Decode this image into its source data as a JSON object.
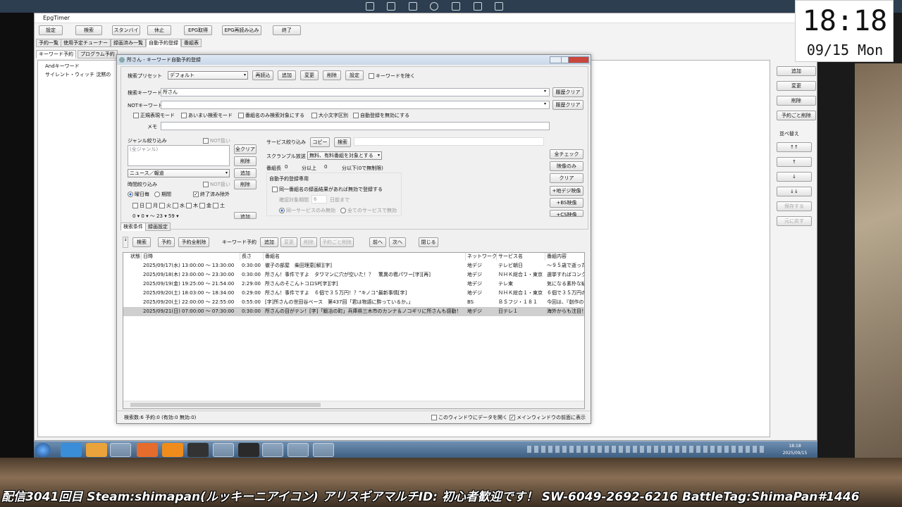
{
  "app_title": "EpgTimer",
  "clock": {
    "time": "18:18",
    "date": "09/15 Mon"
  },
  "toolbar": [
    "設定",
    "検索",
    "スタンバイ",
    "休止",
    "EPG取得",
    "EPG再読み込み",
    "終了"
  ],
  "main_tabs": [
    "予約一覧",
    "使用予定チューナー",
    "録画済み一覧",
    "自動予約登録",
    "番組表"
  ],
  "sub_tabs": [
    "キーワード予約",
    "プログラム予約"
  ],
  "keyword_list": {
    "header": "Andキーワード",
    "item": "サイレント・ウィッチ 沈黙の"
  },
  "right_buttons": [
    "追加",
    "変更",
    "削除",
    "予約ごと削除"
  ],
  "sort": {
    "label": "並べ替え",
    "buttons": [
      "↑↑",
      "↑",
      "↓",
      "↓↓"
    ],
    "save": "保存する",
    "restore": "元に戻す"
  },
  "dialog": {
    "title": "所さん - キーワード自動予約登録",
    "preset_label": "検索プリセット",
    "preset_value": "デフォルト",
    "preset_buttons": [
      "再読込",
      "追加",
      "変更",
      "削除",
      "設定"
    ],
    "exclude_keyword": "キーワードを除く",
    "keyword_label": "検索キーワード",
    "keyword_value": "所さん",
    "not_keyword_label": "NOTキーワード",
    "history_clear": "履歴クリア",
    "options": [
      "正規表現モード",
      "あいまい検索モード",
      "番組名のみ検索対象にする",
      "大小文字区別",
      "自動登録を無効にする"
    ],
    "memo_label": "メモ",
    "genre_label": "ジャンル絞り込み",
    "not_label": "NOT扱い",
    "genre_all": "(全ジャンル)",
    "genre_buttons": [
      "全クリア",
      "削除",
      "追加",
      "削除"
    ],
    "genre_select": "ニュース／報道",
    "time_label": "時間絞り込み",
    "weekday": "曜日毎",
    "period": "期間",
    "exclude_ended": "終了済み除外",
    "days": [
      "日",
      "月",
      "火",
      "水",
      "木",
      "金",
      "土"
    ],
    "time_row": "0 ▾ 0 ▾ ～ 23 ▾ 59 ▾",
    "time_add": "追加",
    "service_label": "サービス絞り込み",
    "copy": "コピー",
    "search": "検索",
    "scramble_label": "スクランブル放送",
    "scramble_value": "無料、有料番組を対象とする",
    "length_label": "番組長",
    "length_min": "0",
    "length_min_unit": "分以上",
    "length_max": "0",
    "length_max_unit": "分以下(0で無制限)",
    "auto_label": "自動予約登録専用",
    "same_title": "同一番組名の録画結果があれば無効で登録する",
    "confirm_label": "確認対象期間",
    "confirm_value": "6",
    "confirm_unit": "日前まで",
    "same_service": "同一サービスのみ無効",
    "all_service": "全てのサービスで無効",
    "side_buttons": [
      "全チェック",
      "映像のみ",
      "クリア",
      "+地デジ映像",
      "+BS映像",
      "+CS映像"
    ],
    "bottom_tabs": [
      "検索条件",
      "録画設定"
    ],
    "actions": [
      "検索",
      "予約",
      "予約全削除"
    ],
    "kw_label": "キーワード予約",
    "kw_buttons": [
      "追加",
      "変更",
      "削除",
      "予約ごと削除"
    ],
    "nav": [
      "前へ",
      "次へ"
    ],
    "close": "閉じる",
    "headers": [
      "状態",
      "日時",
      "長さ",
      "番組名",
      "ネットワーク",
      "サービス名",
      "番組内容"
    ],
    "rows": [
      {
        "dt": "2025/09/17(水) 13:00:00 ～ 13:30:00",
        "len": "0:30:00",
        "title": "徹子の部屋　柴田理恵[解][字]",
        "net": "地デジ",
        "svc": "テレビ朝日",
        "desc": "～９５歳で逝った"
      },
      {
        "dt": "2025/09/18(木) 23:00:00 ～ 23:30:00",
        "len": "0:30:00",
        "title": "所さん！事件ですよ　タワマンに穴が空いた！？　驚異の雹パワー[字][再]",
        "net": "地デジ",
        "svc": "ＮＨＫ総合１・東京",
        "desc": "選挙すればコンク"
      },
      {
        "dt": "2025/09/19(金) 19:25:00 ～ 21:54:00",
        "len": "2:29:00",
        "title": "所さんのそこんトコロSP[字][字]",
        "net": "地デジ",
        "svc": "テレ東",
        "desc": "気になる素朴な疑"
      },
      {
        "dt": "2025/09/20(土) 18:03:00 ～ 18:34:00",
        "len": "0:29:00",
        "title": "所さん！事件ですよ　６個で３５万円！？“キノコ”最新事情[字]",
        "net": "地デジ",
        "svc": "ＮＨＫ総合１・東京",
        "desc": "６個で３５万円の"
      },
      {
        "dt": "2025/09/20(土) 22:00:00 ～ 22:55:00",
        "len": "0:55:00",
        "title": "[字]所さんの世田谷ベース　第437回「君は物語に酔っているか。」",
        "net": "BS",
        "svc": "ＢＳフジ・１８１",
        "desc": "今回は、『創作の"
      },
      {
        "dt": "2025/09/21(日) 07:00:00 ～ 07:30:00",
        "len": "0:30:00",
        "title": "所さんの目がテン！[字]「鍛冶の町」兵庫県三木市のカンナ＆ノコギリに所さんも感動！",
        "net": "地デジ",
        "svc": "日テレ１",
        "desc": "海外からも注目！"
      }
    ],
    "status": "検索数:6 予約:0 (有効:0 無効:0)",
    "open_data": "このウィンドウにデータを開く",
    "front": "メインウィンドウの前面に表示"
  },
  "tray": {
    "time": "18:18",
    "date": "2025/09/15"
  },
  "ticker": "配信3041回目 Steam:shimapan(ルッキーニアイコン) アリスギアマルチID: 初心者歓迎です！ SW-6049-2692-6216 BattleTag:ShimaPan#1446"
}
